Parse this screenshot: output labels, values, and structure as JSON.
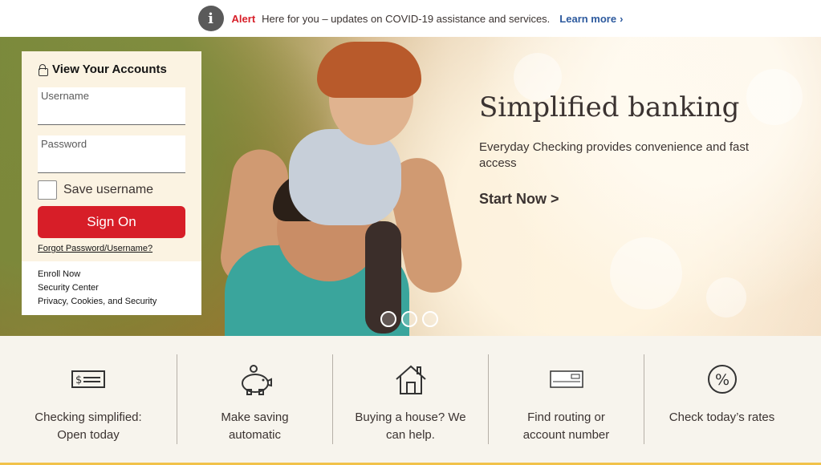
{
  "alert": {
    "icon": "info-icon",
    "label": "Alert",
    "message": "Here for you – updates on COVID-19 assistance and services.",
    "link": "Learn more",
    "link_chevron": "›"
  },
  "signon": {
    "title": "View Your Accounts",
    "username_label": "Username",
    "password_label": "Password",
    "save_username": "Save username",
    "button": "Sign On",
    "forgot": "Forgot Password/Username?",
    "links": [
      "Enroll Now",
      "Security Center",
      "Privacy, Cookies, and Security"
    ]
  },
  "hero": {
    "title": "Simplified banking",
    "subtitle": "Everyday Checking provides convenience and fast access",
    "cta": "Start Now >",
    "slides": 3
  },
  "features": [
    {
      "icon": "check-bill-icon",
      "line1": "Checking simplified:",
      "line2": "Open today"
    },
    {
      "icon": "piggy-bank-icon",
      "line1": "Make saving",
      "line2": "automatic"
    },
    {
      "icon": "house-icon",
      "line1": "Buying a house? We",
      "line2": "can help."
    },
    {
      "icon": "check-icon",
      "line1": "Find routing or",
      "line2": "account number"
    },
    {
      "icon": "percent-icon",
      "line1": "Check today’s rates",
      "line2": ""
    }
  ],
  "colors": {
    "brand_red": "#d71e28",
    "link_blue": "#2d5a9e",
    "panel_cream": "#fbf3e2",
    "accent_gold": "#f1c24a"
  }
}
